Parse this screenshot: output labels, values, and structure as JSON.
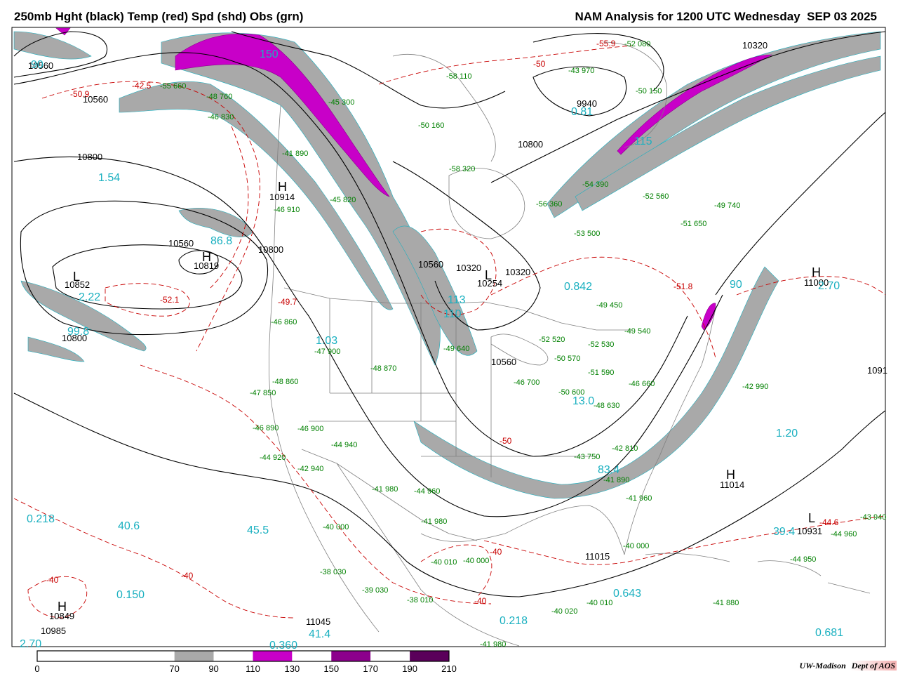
{
  "header": {
    "left_title": "250mb Hght (black) Temp (red) Spd (shd) Obs (grn)",
    "right_title": "NAM Analysis for 1200 UTC Wednesday  SEP 03 2025"
  },
  "credit": {
    "institution": "UW-Madison",
    "dept": "Dept of AOS"
  },
  "legend": {
    "ticks": [
      "0",
      "70",
      "90",
      "110",
      "130",
      "150",
      "170",
      "190",
      "210"
    ],
    "bins": [
      {
        "from": 0,
        "to": 70,
        "color": "#ffffff"
      },
      {
        "from": 70,
        "to": 90,
        "color": "#a9a9a9"
      },
      {
        "from": 90,
        "to": 110,
        "color": "#ffffff"
      },
      {
        "from": 110,
        "to": 130,
        "color": "#c800c8"
      },
      {
        "from": 130,
        "to": 150,
        "color": "#ffffff"
      },
      {
        "from": 150,
        "to": 170,
        "color": "#8c008c"
      },
      {
        "from": 170,
        "to": 190,
        "color": "#ffffff"
      },
      {
        "from": 190,
        "to": 210,
        "color": "#5a005a"
      }
    ]
  },
  "colors": {
    "height_contour": "#000000",
    "temp_contour": "#c80000",
    "obs": "#008000",
    "speed_label": "#1ab0c0",
    "map_outline": "#808080"
  },
  "height_labels": [
    "10560",
    "10560",
    "10800",
    "10914",
    "10560",
    "10800",
    "10800",
    "10560",
    "10320",
    "10320",
    "10254",
    "10560",
    "10800",
    "10320",
    "9940",
    "11000",
    "11014",
    "10931",
    "11015",
    "11045",
    "10849",
    "10985",
    "1091",
    "10819",
    "10852"
  ],
  "temp_labels": [
    "-42.5",
    "-50.9",
    "-52.1",
    "-49.7",
    "-55.9",
    "-50",
    "-40",
    "-40",
    "-40",
    "-44.6",
    "-40",
    "-50",
    "-51.8"
  ],
  "speed_labels": [
    "150",
    "90",
    "1.54",
    "86.8",
    "2.22",
    "99.8",
    "1.03",
    "0.842",
    "2.70",
    "1.20",
    "0.218",
    "40.6",
    "45.5",
    "0.150",
    "0.643",
    "0.218",
    "0.360",
    "41.4",
    "2.70",
    "0.681",
    "39.4",
    "83.4",
    "113",
    "110",
    "13.0",
    "0.81",
    "115",
    "90"
  ],
  "obs_labels": [
    "-41 890",
    "-45 820",
    "-46 910",
    "-46 860",
    "-47 900",
    "-48 870",
    "-48 860",
    "-47 850",
    "-46 890",
    "-46 900",
    "-44 920",
    "-42 940",
    "-44 940",
    "-41 980",
    "-44 960",
    "-40 000",
    "-41 980",
    "-38 030",
    "-39 030",
    "-38 010",
    "-40 010",
    "-40 000",
    "-49 640",
    "-52 520",
    "-50 570",
    "-51 590",
    "-50 600",
    "-48 630",
    "-46 660",
    "-46 700",
    "-42 810",
    "-43 750",
    "-41 890",
    "-41 960",
    "-40 000",
    "-42 990",
    "-43 940",
    "-44 960",
    "-44 950",
    "-41 880",
    "-40 020",
    "-40 010",
    "-51 650",
    "-49 450",
    "-49 540",
    "-52 530",
    "-53 500",
    "-56 360",
    "-54 390",
    "-52 560",
    "-49 740",
    "-58 320",
    "-50 160",
    "-43 970",
    "-50 150",
    "-55 660",
    "-48 760",
    "-46 830",
    "-58 110",
    "-45 300",
    "-52 080",
    "-41 980"
  ],
  "pressure_centers": [
    "H",
    "L"
  ]
}
